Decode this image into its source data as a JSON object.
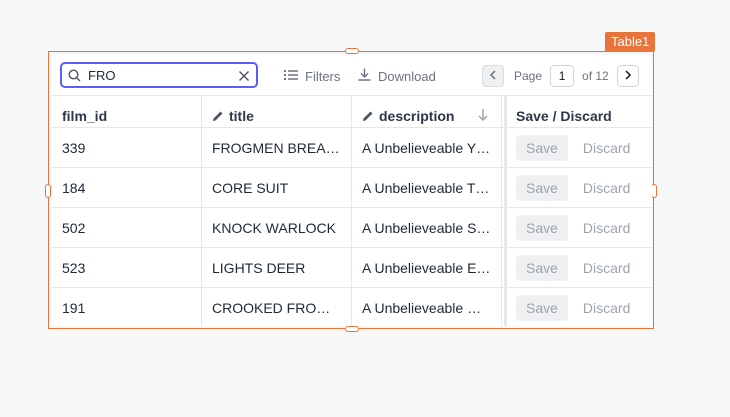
{
  "widget": {
    "name": "Table1"
  },
  "toolbar": {
    "search_value": "FRO",
    "filters_label": "Filters",
    "download_label": "Download",
    "page_label": "Page",
    "page_current": "1",
    "page_of": "of 12"
  },
  "columns": [
    {
      "label": "film_id",
      "editable": false
    },
    {
      "label": "title",
      "editable": true
    },
    {
      "label": "description",
      "editable": true,
      "sorted": "desc"
    },
    {
      "label": "Save / Discard"
    }
  ],
  "rows": [
    {
      "film_id": "339",
      "title": "FROGMEN BREA…",
      "description": "A Unbelieveable Y…"
    },
    {
      "film_id": "184",
      "title": "CORE SUIT",
      "description": "A Unbelieveable T…"
    },
    {
      "film_id": "502",
      "title": "KNOCK WARLOCK",
      "description": "A Unbelieveable S…"
    },
    {
      "film_id": "523",
      "title": "LIGHTS DEER",
      "description": "A Unbelieveable E…"
    },
    {
      "film_id": "191",
      "title": "CROOKED FRO…",
      "description": "A Unbelieveable …"
    }
  ],
  "actions": {
    "save_label": "Save",
    "discard_label": "Discard"
  },
  "colors": {
    "accent": "#5b5ef7",
    "widget_border": "#e8743b"
  },
  "icons": [
    "search-icon",
    "clear-icon",
    "filters-icon",
    "download-icon",
    "chevron-left-icon",
    "chevron-right-icon",
    "pencil-icon",
    "arrow-down-icon"
  ]
}
